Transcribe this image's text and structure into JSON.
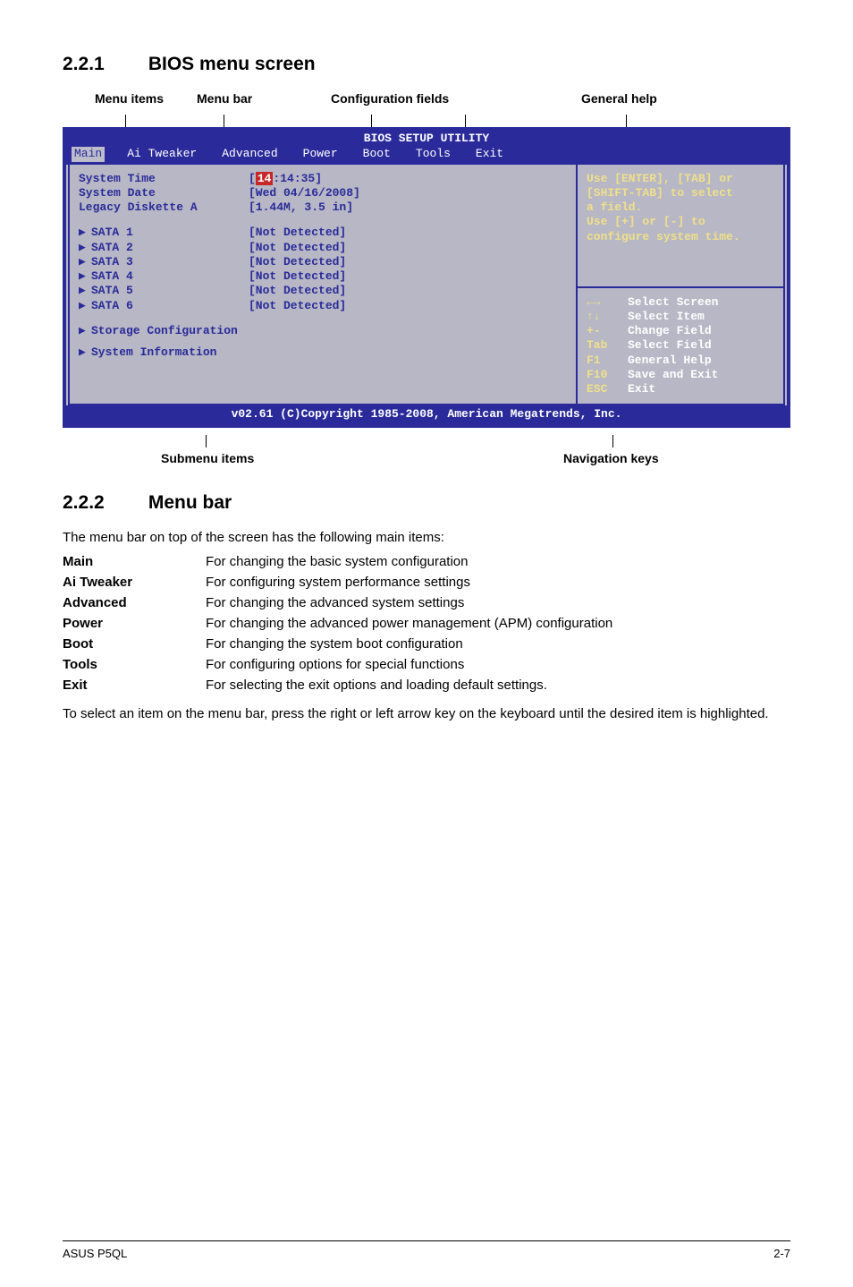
{
  "section1": {
    "number": "2.2.1",
    "title": "BIOS menu screen"
  },
  "labels": {
    "menu_items": "Menu items",
    "menu_bar": "Menu bar",
    "config_fields": "Configuration fields",
    "general_help": "General help",
    "submenu_items": "Submenu items",
    "nav_keys": "Navigation keys"
  },
  "bios": {
    "title": "BIOS SETUP UTILITY",
    "menubar": [
      "Main",
      "Ai Tweaker",
      "Advanced",
      "Power",
      "Boot",
      "Tools",
      "Exit"
    ],
    "fields": {
      "system_time": {
        "label": "System Time",
        "value_prefix": "[",
        "value_hl": "14",
        "value_rest": ":14:35]"
      },
      "system_date": {
        "label": "System Date",
        "value": "[Wed 04/16/2008]"
      },
      "legacy": {
        "label": "Legacy Diskette A",
        "value": "[1.44M, 3.5 in]"
      }
    },
    "sata": [
      {
        "label": "SATA 1",
        "value": "[Not Detected]"
      },
      {
        "label": "SATA 2",
        "value": "[Not Detected]"
      },
      {
        "label": "SATA 3",
        "value": "[Not Detected]"
      },
      {
        "label": "SATA 4",
        "value": "[Not Detected]"
      },
      {
        "label": "SATA 5",
        "value": "[Not Detected]"
      },
      {
        "label": "SATA 6",
        "value": "[Not Detected]"
      }
    ],
    "extra_submenus": [
      "Storage Configuration",
      "System Information"
    ],
    "help_text": [
      "Use [ENTER], [TAB] or",
      "[SHIFT-TAB] to select",
      "a field.",
      "",
      "Use [+] or [-] to",
      "configure system time."
    ],
    "nav": [
      {
        "key": "←→",
        "action": "Select Screen"
      },
      {
        "key": "↑↓",
        "action": "Select Item"
      },
      {
        "key": "+-",
        "action": "Change Field"
      },
      {
        "key": "Tab",
        "action": "Select Field"
      },
      {
        "key": "F1",
        "action": "General Help"
      },
      {
        "key": "F10",
        "action": "Save and Exit"
      },
      {
        "key": "ESC",
        "action": "Exit"
      }
    ],
    "footer": "v02.61 (C)Copyright 1985-2008, American Megatrends, Inc."
  },
  "section2": {
    "number": "2.2.2",
    "title": "Menu bar"
  },
  "intro": "The menu bar on top of the screen has the following main items:",
  "definitions": [
    {
      "term": "Main",
      "desc": "For changing the basic system configuration"
    },
    {
      "term": "Ai Tweaker",
      "desc": "For configuring system performance settings"
    },
    {
      "term": "Advanced",
      "desc": "For changing the advanced system settings"
    },
    {
      "term": "Power",
      "desc": "For changing the advanced power management (APM) configuration"
    },
    {
      "term": "Boot",
      "desc": "For changing the system boot configuration"
    },
    {
      "term": "Tools",
      "desc": "For configuring options for special functions"
    },
    {
      "term": "Exit",
      "desc": "For selecting the exit options and loading default settings."
    }
  ],
  "closing": "To select an item on the menu bar, press the right or left arrow key on the keyboard until the desired item is highlighted.",
  "footer": {
    "left": "ASUS P5QL",
    "right": "2-7"
  }
}
